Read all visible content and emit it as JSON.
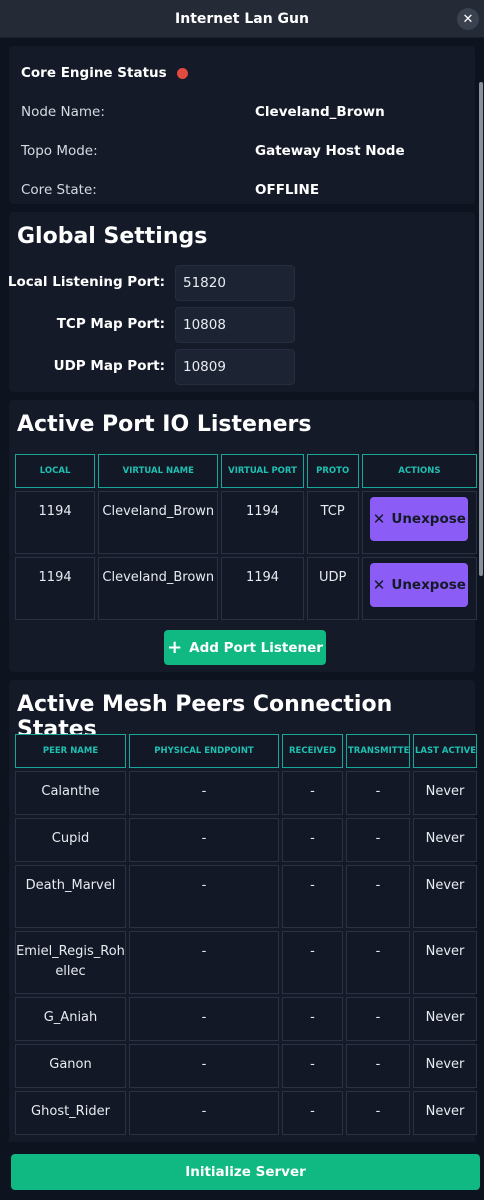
{
  "window": {
    "title": "Internet Lan Gun",
    "close_label": "✕"
  },
  "status": {
    "heading": "Core Engine Status",
    "indicator_color": "#e04a3f",
    "rows": [
      {
        "key": "Node Name:",
        "value": "Cleveland_Brown"
      },
      {
        "key": "Topo Mode:",
        "value": "Gateway Host Node"
      },
      {
        "key": "Core State:",
        "value": "OFFLINE"
      }
    ]
  },
  "settings": {
    "title": "Global Settings",
    "fields": [
      {
        "label": "Local Listening Port:",
        "value": "51820"
      },
      {
        "label": "TCP Map Port:",
        "value": "10808"
      },
      {
        "label": "UDP Map Port:",
        "value": "10809"
      }
    ]
  },
  "listeners": {
    "title": "Active Port IO Listeners",
    "columns": [
      "LOCAL",
      "VIRTUAL NAME",
      "VIRTUAL PORT",
      "PROTO",
      "ACTIONS"
    ],
    "rows": [
      {
        "local": "1194",
        "virtual_name": "Cleveland_Brown",
        "virtual_port": "1194",
        "proto": "TCP",
        "action": "Unexpose"
      },
      {
        "local": "1194",
        "virtual_name": "Cleveland_Brown",
        "virtual_port": "1194",
        "proto": "UDP",
        "action": "Unexpose"
      }
    ],
    "add_button": "Add Port Listener"
  },
  "peers": {
    "title": "Active Mesh Peers Connection States",
    "columns": [
      "PEER NAME",
      "PHYSICAL ENDPOINT",
      "RECEIVED",
      "TRANSMITTED",
      "LAST ACTIVE"
    ],
    "rows": [
      {
        "name": "Calanthe",
        "endpoint": "-",
        "received": "-",
        "transmitted": "-",
        "last_active": "Never"
      },
      {
        "name": "Cupid",
        "endpoint": "-",
        "received": "-",
        "transmitted": "-",
        "last_active": "Never"
      },
      {
        "name": "Death_Marvel",
        "endpoint": "-",
        "received": "-",
        "transmitted": "-",
        "last_active": "Never"
      },
      {
        "name": "Emiel_Regis_Rohellec",
        "endpoint": "-",
        "received": "-",
        "transmitted": "-",
        "last_active": "Never"
      },
      {
        "name": "G_Aniah",
        "endpoint": "-",
        "received": "-",
        "transmitted": "-",
        "last_active": "Never"
      },
      {
        "name": "Ganon",
        "endpoint": "-",
        "received": "-",
        "transmitted": "-",
        "last_active": "Never"
      },
      {
        "name": "Ghost_Rider",
        "endpoint": "-",
        "received": "-",
        "transmitted": "-",
        "last_active": "Never"
      }
    ]
  },
  "footer": {
    "init_button": "Initialize Server"
  },
  "colors": {
    "accent_green": "#10b981",
    "accent_purple": "#8b5cf6",
    "accent_teal": "#1fc0b2"
  }
}
